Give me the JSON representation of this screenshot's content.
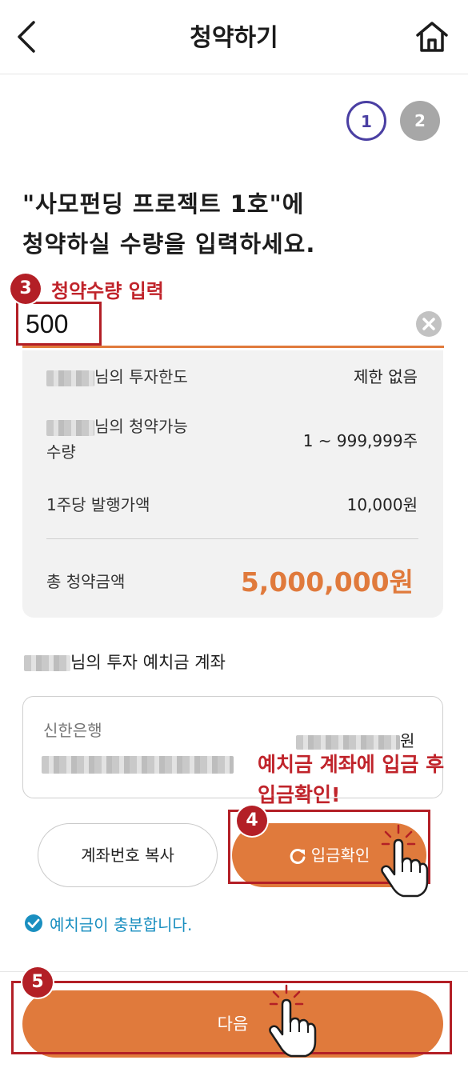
{
  "header": {
    "title": "청약하기"
  },
  "steps": [
    "1",
    "2"
  ],
  "headline": {
    "line1": "\"사모펀딩 프로젝트 1호\"에",
    "line2": "청약하실 수량을 입력하세요."
  },
  "quantity_input": {
    "value": "500"
  },
  "info": {
    "limit_label": "님의 투자한도",
    "limit_value": "제한 없음",
    "available_label_1": "님의 청약가능",
    "available_label_2": "수량",
    "available_value": "1 ~ 999,999주",
    "price_label": "1주당 발행가액",
    "price_value": "10,000원",
    "total_label": "총 청약금액",
    "total_value": "5,000,000원"
  },
  "account": {
    "title": "님의 투자 예치금 계좌",
    "bank": "신한은행",
    "owner_suffix": "원"
  },
  "buttons": {
    "copy": "계좌번호 복사",
    "confirm": "입금확인",
    "next": "다음"
  },
  "status": {
    "text": "예치금이 충분합니다."
  },
  "annotations": {
    "step3_num": "3",
    "step3_text": "청약수량 입력",
    "step4_num": "4",
    "step4_text_line1": "예치금 계좌에 입금 후",
    "step4_text_line2": "입금확인!",
    "step5_num": "5"
  },
  "colors": {
    "accent": "#e07a3c",
    "annotation": "#b31f26",
    "step_active": "#4a3fa3",
    "status": "#1a8fc0"
  }
}
